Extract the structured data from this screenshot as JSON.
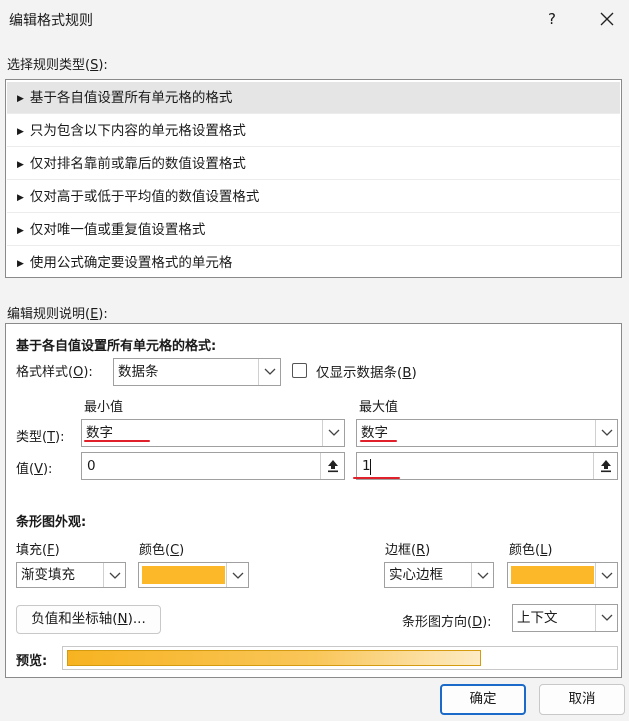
{
  "dialog": {
    "title": "编辑格式规则",
    "help_glyph": "?"
  },
  "rule_type": {
    "label_pre": "选择规则类型(",
    "label_key": "S",
    "label_post": "):",
    "items": [
      {
        "label": "基于各自值设置所有单元格的格式",
        "selected": true
      },
      {
        "label": "只为包含以下内容的单元格设置格式"
      },
      {
        "label": "仅对排名靠前或靠后的数值设置格式"
      },
      {
        "label": "仅对高于或低于平均值的数值设置格式"
      },
      {
        "label": "仅对唯一值或重复值设置格式"
      },
      {
        "label": "使用公式确定要设置格式的单元格"
      }
    ]
  },
  "description": {
    "label_pre": "编辑规则说明(",
    "label_key": "E",
    "label_post": "):",
    "heading": "基于各自值设置所有单元格的格式:",
    "format_style": {
      "label_pre": "格式样式(",
      "label_key": "O",
      "label_post": "):",
      "value": "数据条"
    },
    "show_bar_only": {
      "label_pre": "仅显示数据条(",
      "label_key": "B",
      "label_post": ")",
      "checked": false
    },
    "min_header": "最小值",
    "max_header": "最大值",
    "type_label": {
      "pre": "类型(",
      "key": "T",
      "post": "):"
    },
    "value_label": {
      "pre": "值(",
      "key": "V",
      "post": "):"
    },
    "min_type": "数字",
    "max_type": "数字",
    "min_value": "0",
    "max_value": "1",
    "appearance_heading": "条形图外观:",
    "fill": {
      "pre": "填充(",
      "key": "F",
      "post": ")",
      "value": "渐变填充"
    },
    "fill_color": {
      "pre": "颜色(",
      "key": "C",
      "post": ")",
      "color": "#FDB829"
    },
    "border": {
      "pre": "边框(",
      "key": "R",
      "post": ")",
      "value": "实心边框"
    },
    "border_color": {
      "pre": "颜色(",
      "key": "L",
      "post": ")",
      "color": "#FDB829"
    },
    "neg_axis_button": {
      "pre": "负值和坐标轴(",
      "key": "N",
      "post": ")..."
    },
    "direction": {
      "pre": "条形图方向(",
      "key": "D",
      "post": "):",
      "value": "上下文"
    },
    "preview_label": "预览:",
    "accent_color": "#E0202A"
  },
  "buttons": {
    "ok": "确定",
    "cancel": "取消"
  }
}
